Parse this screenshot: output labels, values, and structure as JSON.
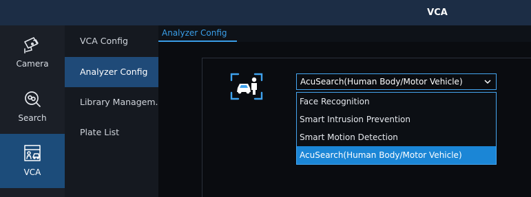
{
  "window": {
    "title": "VCA"
  },
  "leftnav": {
    "items": [
      {
        "label": "Camera",
        "icon": "camera-icon"
      },
      {
        "label": "Search",
        "icon": "search-icon"
      },
      {
        "label": "VCA",
        "icon": "vca-icon",
        "active": true
      }
    ]
  },
  "subnav": {
    "items": [
      {
        "label": "VCA Config"
      },
      {
        "label": "Analyzer Config",
        "active": true
      },
      {
        "label": "Library Managem..."
      },
      {
        "label": "Plate List"
      }
    ]
  },
  "tabs": [
    {
      "label": "Analyzer Config",
      "active": true
    }
  ],
  "analyzer": {
    "icon": "vehicle-person-analyzer-icon",
    "select": {
      "value": "AcuSearch(Human Body/Motor Vehicle)"
    },
    "options": [
      "Face Recognition",
      "Smart Intrusion Prevention",
      "Smart Motion Detection",
      "AcuSearch(Human Body/Motor Vehicle)"
    ],
    "selected_option": "AcuSearch(Human Body/Motor Vehicle)"
  },
  "colors": {
    "accent": "#3a9ee8",
    "highlight": "#1b86d6",
    "topbar": "#1c2d45"
  }
}
